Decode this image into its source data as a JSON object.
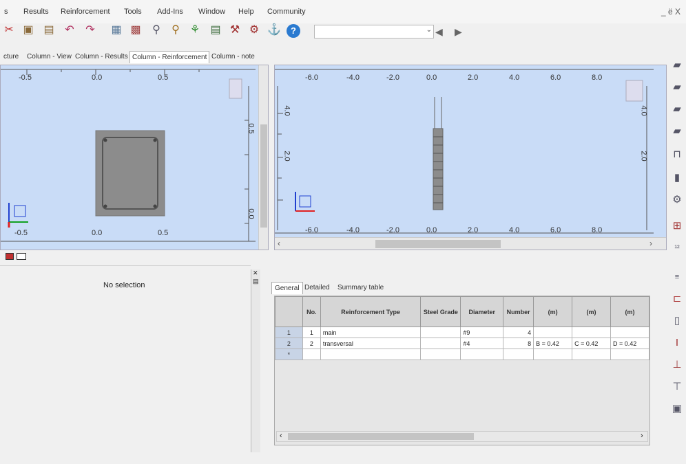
{
  "menubar": {
    "items": [
      "s",
      "Results",
      "Reinforcement",
      "Tools",
      "Add-Ins",
      "Window",
      "Help",
      "Community"
    ],
    "window_controls": "_ ё X"
  },
  "toolbar": {
    "icons": [
      "cut-icon",
      "copy-icon",
      "paste-icon",
      "undo-icon",
      "redo-icon",
      "table-icon",
      "calc-icon",
      "zoom-icon",
      "zoom-window-icon",
      "tree-icon",
      "list-icon",
      "wrench-icon",
      "gear-icon",
      "tool-icon",
      "help-icon"
    ],
    "combo_value": "",
    "prev_arrow": "◀",
    "next_arrow": "▶"
  },
  "tabs": [
    "cture",
    "Column - View",
    "Column - Results",
    "Column - Reinforcement",
    "Column - note"
  ],
  "active_tab": "Column - Reinforcement",
  "left_view": {
    "top_ticks": [
      "-0.5",
      "0.0",
      "0.5"
    ],
    "bottom_ticks": [
      "-0.5",
      "0.0",
      "0.5"
    ],
    "right_ticks": [
      "0.5",
      "0.0"
    ]
  },
  "right_view": {
    "top_ticks": [
      "-6.0",
      "-4.0",
      "-2.0",
      "0.0",
      "2.0",
      "4.0",
      "6.0",
      "8.0"
    ],
    "bottom_ticks": [
      "-6.0",
      "-4.0",
      "-2.0",
      "0.0",
      "2.0",
      "4.0",
      "6.0",
      "8.0"
    ],
    "left_ticks": [
      "4.0",
      "2.0"
    ],
    "right_ticks": [
      "4.0",
      "2.0"
    ]
  },
  "selection_panel": {
    "text": "No selection"
  },
  "subtabs": [
    "General",
    "Detailed",
    "Summary table"
  ],
  "grid": {
    "headers": [
      "No.",
      "Reinforcement Type",
      "Steel Grade",
      "Diameter",
      "Number",
      "(m)",
      "(m)",
      "(m)"
    ],
    "rows": [
      {
        "rowhead": "1",
        "no": "1",
        "type": "main",
        "grade": "",
        "diameter": "#9",
        "number": "4",
        "c1": "",
        "c2": "",
        "c3": ""
      },
      {
        "rowhead": "2",
        "no": "2",
        "type": "transversal",
        "grade": "",
        "diameter": "#4",
        "number": "8",
        "c1": "B = 0.42",
        "c2": "C = 0.42",
        "c3": "D = 0.42"
      },
      {
        "rowhead": "*",
        "no": "",
        "type": "",
        "grade": "",
        "diameter": "",
        "number": "",
        "c1": "",
        "c2": "",
        "c3": ""
      }
    ]
  },
  "colors": {
    "view_bg": "#c9dcf7",
    "section_gray": "#8c8c8c",
    "axis_red": "#e02020",
    "axis_blue": "#2040d0",
    "axis_green": "#10a020"
  }
}
